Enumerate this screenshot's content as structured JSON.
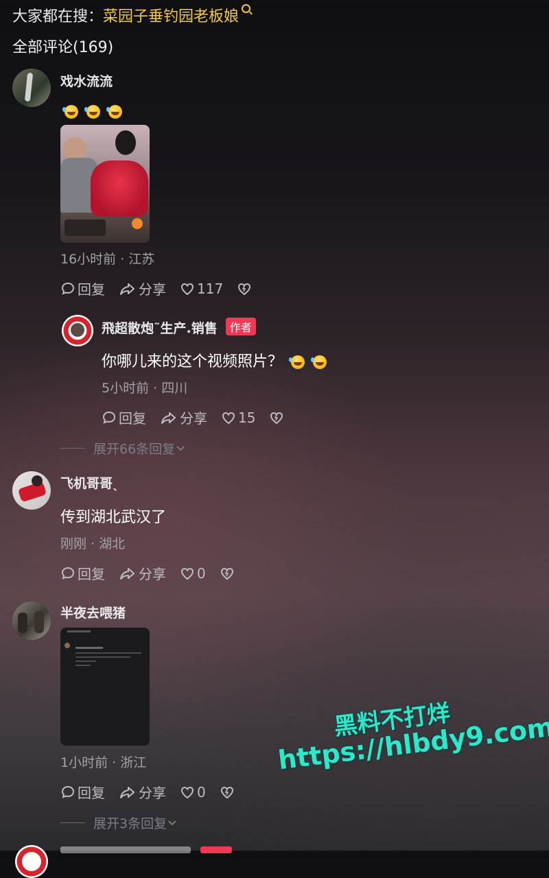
{
  "search_bar": {
    "prefix": "大家都在搜：",
    "keyword": "菜园子垂钓园老板娘"
  },
  "section_title": "全部评论(169)",
  "comments": [
    {
      "username": "戏水流流",
      "emojis": 3,
      "meta": "16小时前 · 江苏",
      "reply_label": "回复",
      "share_label": "分享",
      "likes": "117"
    },
    {
      "username": "飛超散炮˜生产.销售",
      "badge": "作者",
      "text": "你哪儿来的这个视频照片？",
      "emojis": 2,
      "meta": "5小时前 · 四川",
      "reply_label": "回复",
      "share_label": "分享",
      "likes": "15"
    },
    {
      "username": "飞机哥哥ˎ",
      "text": "传到湖北武汉了",
      "meta": "刚刚 · 湖北",
      "reply_label": "回复",
      "share_label": "分享",
      "likes": "0"
    },
    {
      "username": "半夜去喂猪",
      "meta": "1小时前 · 浙江",
      "reply_label": "回复",
      "share_label": "分享",
      "likes": "0"
    }
  ],
  "expand_replies": [
    {
      "label": "展开66条回复"
    },
    {
      "label": "展开3条回复"
    }
  ],
  "watermark": {
    "line1": "黑料不打烊",
    "line2": "https://hlbdy9.com",
    "color": "#32e6c8"
  },
  "colors": {
    "keyword": "#f3c94f",
    "author_badge": "#f03a55"
  }
}
